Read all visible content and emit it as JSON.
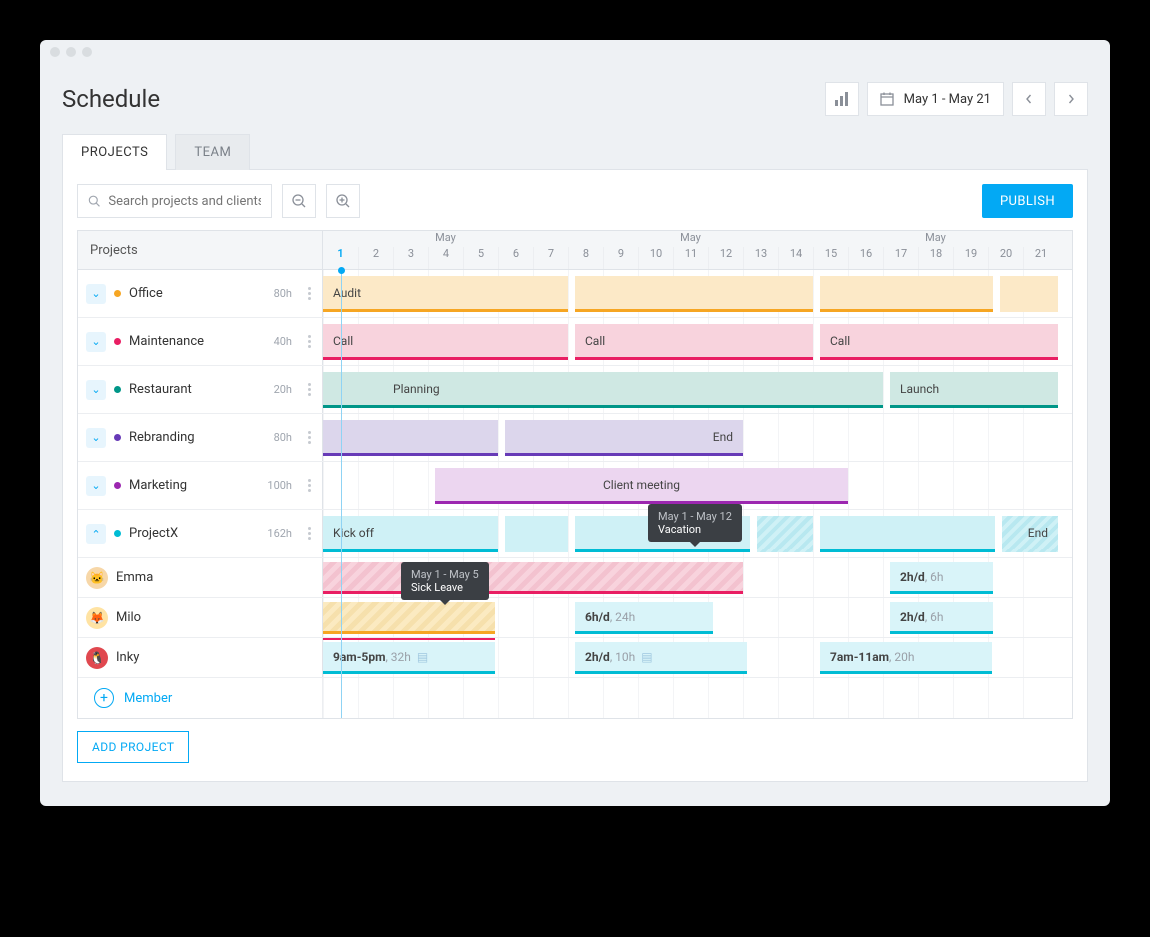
{
  "title": "Schedule",
  "date_range": "May 1 - May 21",
  "tabs": {
    "projects": "PROJECTS",
    "team": "TEAM"
  },
  "search_placeholder": "Search projects and clients",
  "publish_label": "PUBLISH",
  "sidebar_header": "Projects",
  "month_label": "May",
  "day_labels": [
    "1",
    "2",
    "3",
    "4",
    "5",
    "6",
    "7",
    "8",
    "9",
    "10",
    "11",
    "12",
    "13",
    "14",
    "15",
    "16",
    "17",
    "18",
    "19",
    "20",
    "21"
  ],
  "projects": [
    {
      "name": "Office",
      "hours": "80h",
      "color": "#f6a623"
    },
    {
      "name": "Maintenance",
      "hours": "40h",
      "color": "#e91e63"
    },
    {
      "name": "Restaurant",
      "hours": "20h",
      "color": "#009688"
    },
    {
      "name": "Rebranding",
      "hours": "80h",
      "color": "#673ab7"
    },
    {
      "name": "Marketing",
      "hours": "100h",
      "color": "#9c27b0"
    },
    {
      "name": "ProjectX",
      "hours": "162h",
      "color": "#00bcd4"
    }
  ],
  "bars": {
    "office_audit": "Audit",
    "maint_call": "Call",
    "rest_planning": "Planning",
    "rest_launch": "Launch",
    "rebrand_end": "End",
    "marketing_meeting": "Client meeting",
    "px_kickoff": "Kick off",
    "px_end": "End"
  },
  "members": [
    {
      "name": "Emma"
    },
    {
      "name": "Milo"
    },
    {
      "name": "Inky"
    }
  ],
  "member_bars": {
    "emma_a": {
      "bold": "2h/d",
      "rest": ", 6h"
    },
    "milo_a": {
      "bold": "6h/d",
      "rest": ", 24h"
    },
    "milo_b": {
      "bold": "2h/d",
      "rest": ", 6h"
    },
    "inky_a": {
      "bold": "9am-5pm",
      "rest": ", 32h"
    },
    "inky_b": {
      "bold": "2h/d",
      "rest": ", 10h"
    },
    "inky_c": {
      "bold": "7am-11am",
      "rest": ", 20h"
    }
  },
  "tooltips": {
    "sick": {
      "date": "May 1 - May 5",
      "label": "Sick Leave"
    },
    "vacation": {
      "date": "May 1 - May 12",
      "label": "Vacation"
    }
  },
  "add_member": "Member",
  "add_project": "ADD PROJECT"
}
